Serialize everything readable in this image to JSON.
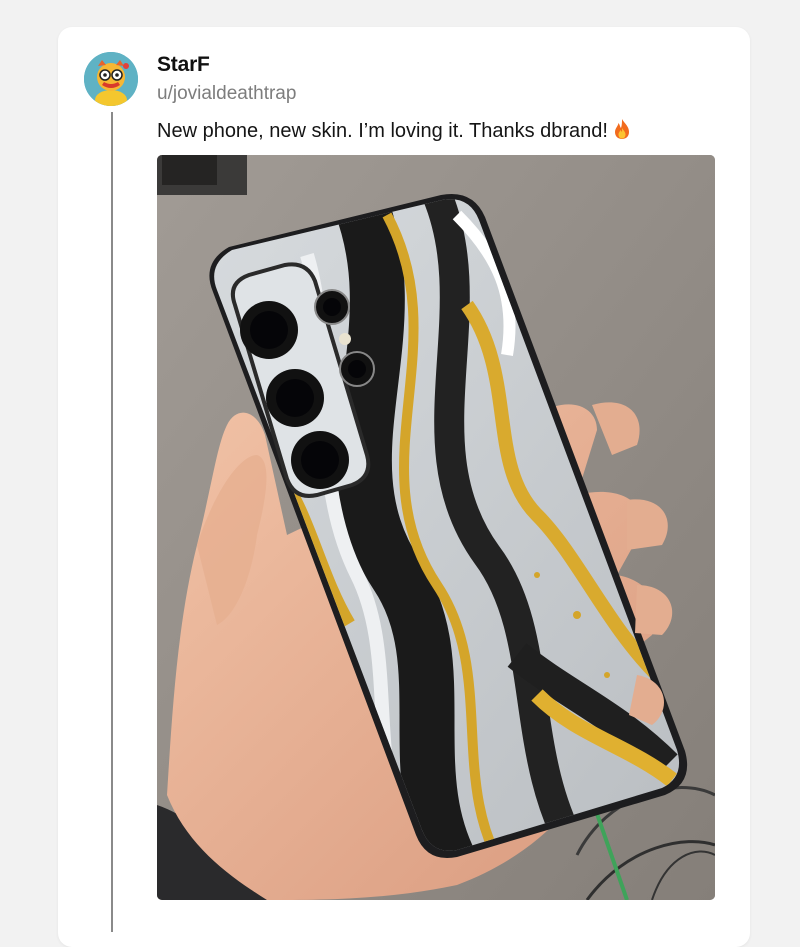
{
  "post": {
    "display_name": "StarF",
    "handle": "u/jovialdeathtrap",
    "text": "New phone, new skin. I’m loving it. Thanks dbrand!",
    "emoji_icon": "fire-icon"
  },
  "colors": {
    "card_background": "#ffffff",
    "page_background": "#f2f2f2",
    "thread_line": "#8a8a8a",
    "handle_text": "#7d7d7d",
    "avatar_background": "#5fb2c4"
  }
}
